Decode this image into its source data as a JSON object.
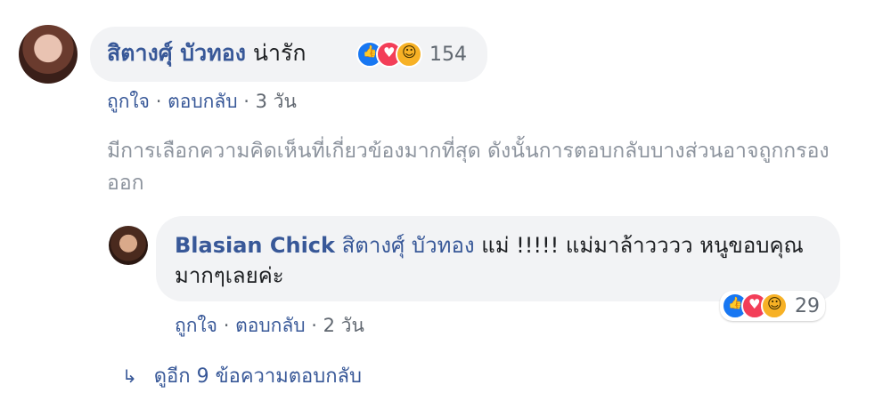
{
  "comment": {
    "author": "สิตางศุ์ บัวทอง",
    "text": "น่ารัก",
    "reaction_count": "154",
    "reactions": [
      "like-icon",
      "love-icon",
      "haha-icon"
    ],
    "actions": {
      "like": "ถูกใจ",
      "reply": "ตอบกลับ",
      "sep": "·",
      "time": "3 วัน"
    }
  },
  "relevance_note": "มีการเลือกความคิดเห็นที่เกี่ยวข้องมากที่สุด ดังนั้นการตอบกลับบางส่วนอาจถูกกรองออก",
  "reply": {
    "author": "Blasian Chick",
    "mention": "สิตางศุ์ บัวทอง",
    "text": "แม่ !!!!! แม่มาล้าวววว หนูขอบคุณมากๆเลยค่ะ",
    "reaction_count": "29",
    "reactions": [
      "like-icon",
      "love-icon",
      "haha-icon"
    ],
    "actions": {
      "like": "ถูกใจ",
      "reply": "ตอบกลับ",
      "sep": "·",
      "time": "2 วัน"
    }
  },
  "view_more": {
    "label": "ดูอีก 9 ข้อความตอบกลับ",
    "icon": "reply-arrow-icon"
  }
}
